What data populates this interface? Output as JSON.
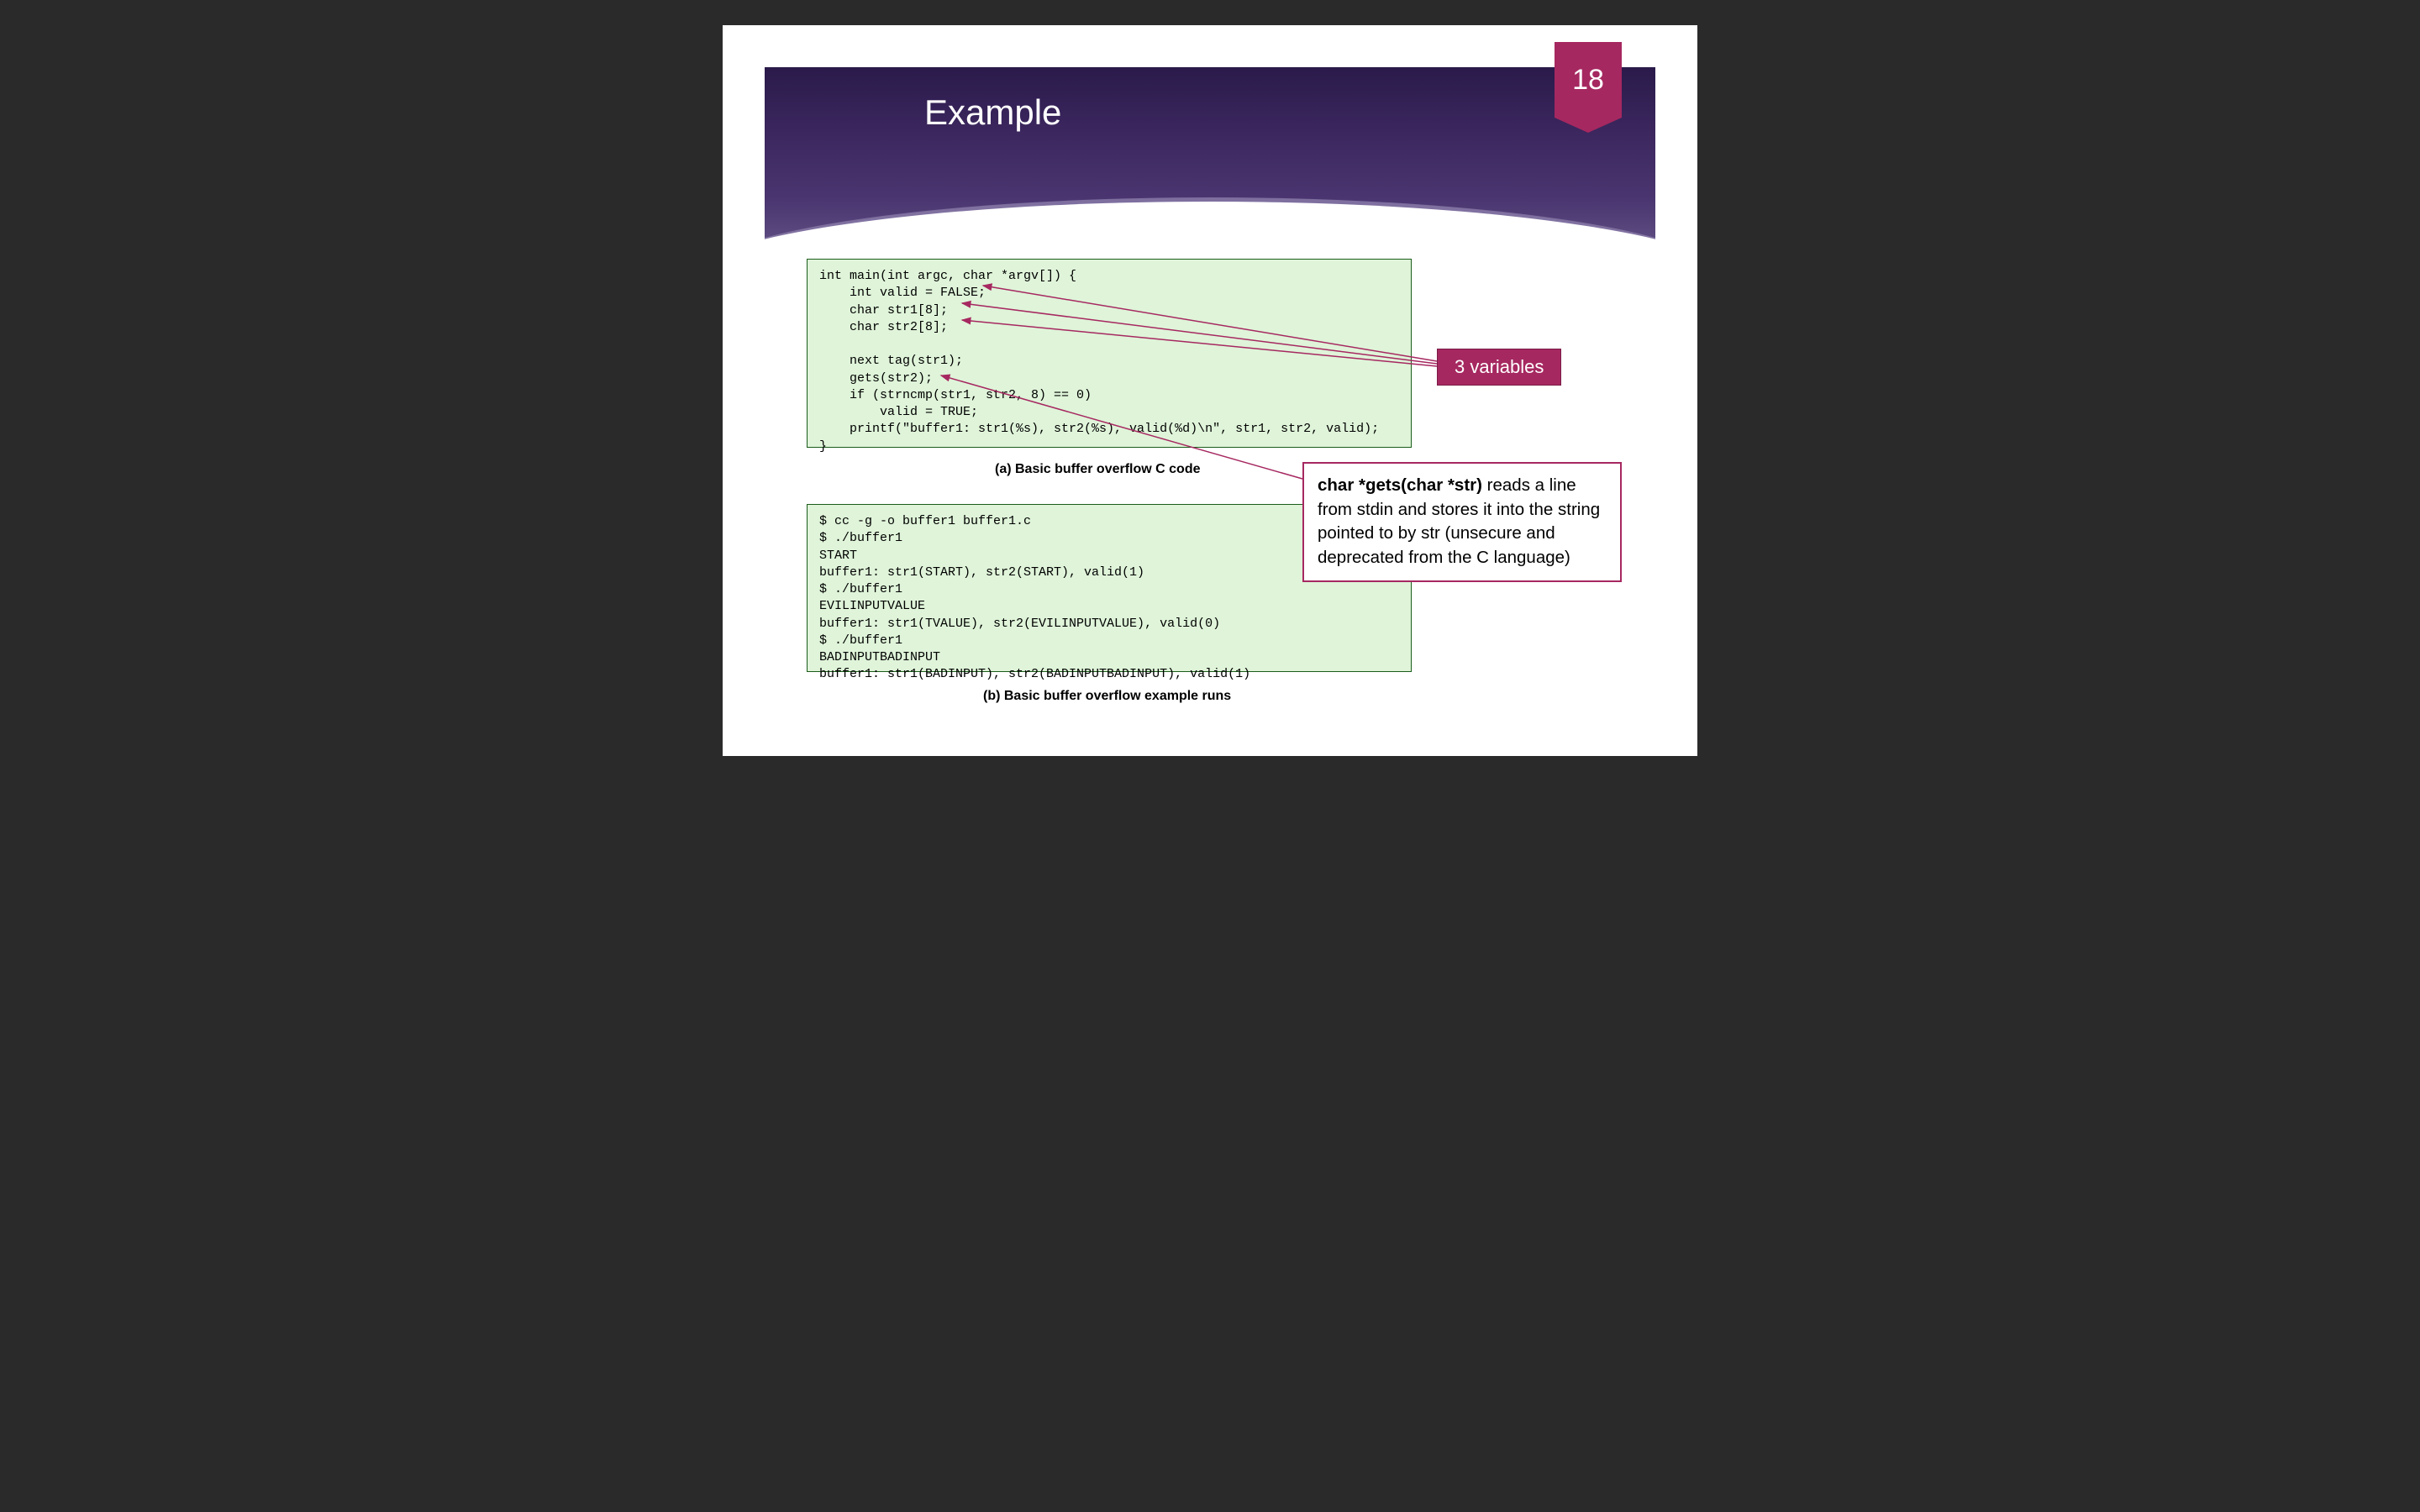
{
  "slide": {
    "title": "Example",
    "page_number": "18"
  },
  "code_a": "int main(int argc, char *argv[]) {\n    int valid = FALSE;\n    char str1[8];\n    char str2[8];\n\n    next tag(str1);\n    gets(str2);\n    if (strncmp(str1, str2, 8) == 0)\n        valid = TRUE;\n    printf(\"buffer1: str1(%s), str2(%s), valid(%d)\\n\", str1, str2, valid);\n}",
  "caption_a": "(a) Basic buffer overflow C code",
  "code_b": "$ cc -g -o buffer1 buffer1.c\n$ ./buffer1\nSTART\nbuffer1: str1(START), str2(START), valid(1)\n$ ./buffer1\nEVILINPUTVALUE\nbuffer1: str1(TVALUE), str2(EVILINPUTVALUE), valid(0)\n$ ./buffer1\nBADINPUTBADINPUT\nbuffer1: str1(BADINPUT), str2(BADINPUTBADINPUT), valid(1)",
  "caption_b": "(b) Basic buffer overflow example runs",
  "callout_1": "3 variables",
  "callout_2": {
    "bold": "char *gets(char *str)",
    "rest": " reads a line from stdin and stores it into the string pointed to by str (unsecure and deprecated from the C language)"
  }
}
